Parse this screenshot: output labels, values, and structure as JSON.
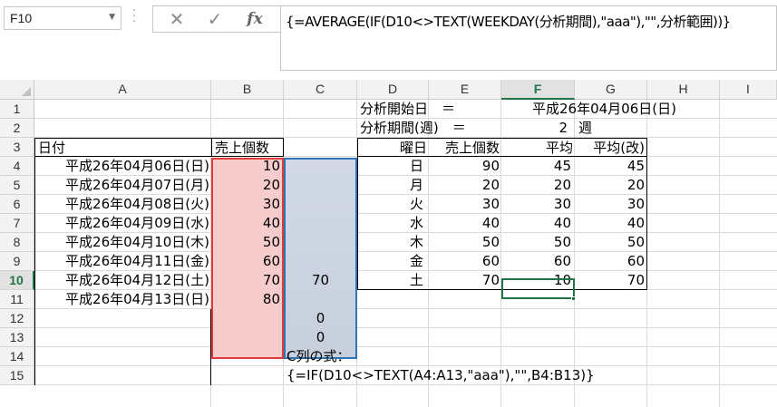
{
  "namebox": {
    "value": "F10",
    "arrow": "▼"
  },
  "formula_bar": {
    "cancel": "✕",
    "enter": "✓",
    "fx": "fx",
    "formula": "{=AVERAGE(IF(D10<>TEXT(WEEKDAY(分析期間),\"aaa\"),\"\",分析範囲))}"
  },
  "columns": [
    "A",
    "B",
    "C",
    "D",
    "E",
    "F",
    "G",
    "H",
    "I"
  ],
  "rows": [
    "1",
    "2",
    "3",
    "4",
    "5",
    "6",
    "7",
    "8",
    "9",
    "10",
    "11",
    "12",
    "13",
    "14",
    "15"
  ],
  "active_cell": {
    "column": "F",
    "row": "10"
  },
  "header_labels": {
    "start_label": "分析開始日　＝",
    "start_value": "平成26年04月06日(日)",
    "period_label": "分析期間(週)　＝",
    "period_value": "2",
    "period_unit": "週"
  },
  "left_table": {
    "headers": {
      "date": "日付",
      "sales": "売上個数"
    },
    "rows": [
      {
        "date": "平成26年04月06日(日)",
        "sales": "10"
      },
      {
        "date": "平成26年04月07日(月)",
        "sales": "20"
      },
      {
        "date": "平成26年04月08日(火)",
        "sales": "30"
      },
      {
        "date": "平成26年04月09日(水)",
        "sales": "40"
      },
      {
        "date": "平成26年04月10日(木)",
        "sales": "50"
      },
      {
        "date": "平成26年04月11日(金)",
        "sales": "60"
      },
      {
        "date": "平成26年04月12日(土)",
        "sales": "70"
      },
      {
        "date": "平成26年04月13日(日)",
        "sales": "80"
      }
    ]
  },
  "column_c": {
    "values": [
      {
        "row": "10",
        "value": "70"
      },
      {
        "row": "12",
        "value": "0"
      },
      {
        "row": "13",
        "value": "0"
      }
    ],
    "note_label": "C列の式：",
    "note_formula": "{=IF(D10<>TEXT(A4:A13,\"aaa\"),\"\",B4:B13)}"
  },
  "right_table": {
    "headers": {
      "weekday": "曜日",
      "sales": "売上個数",
      "avg": "平均",
      "avg_fixed": "平均(改)"
    },
    "rows": [
      {
        "weekday": "日",
        "sales": "90",
        "avg": "45",
        "avg_fixed": "45"
      },
      {
        "weekday": "月",
        "sales": "20",
        "avg": "20",
        "avg_fixed": "20"
      },
      {
        "weekday": "火",
        "sales": "30",
        "avg": "30",
        "avg_fixed": "30"
      },
      {
        "weekday": "水",
        "sales": "40",
        "avg": "40",
        "avg_fixed": "40"
      },
      {
        "weekday": "木",
        "sales": "50",
        "avg": "50",
        "avg_fixed": "50"
      },
      {
        "weekday": "金",
        "sales": "60",
        "avg": "60",
        "avg_fixed": "60"
      },
      {
        "weekday": "土",
        "sales": "70",
        "avg": "10",
        "avg_fixed": "70"
      }
    ]
  },
  "colors": {
    "accent": "#217346",
    "red_range": "#e03b3b",
    "blue_range": "#2e75b6"
  }
}
